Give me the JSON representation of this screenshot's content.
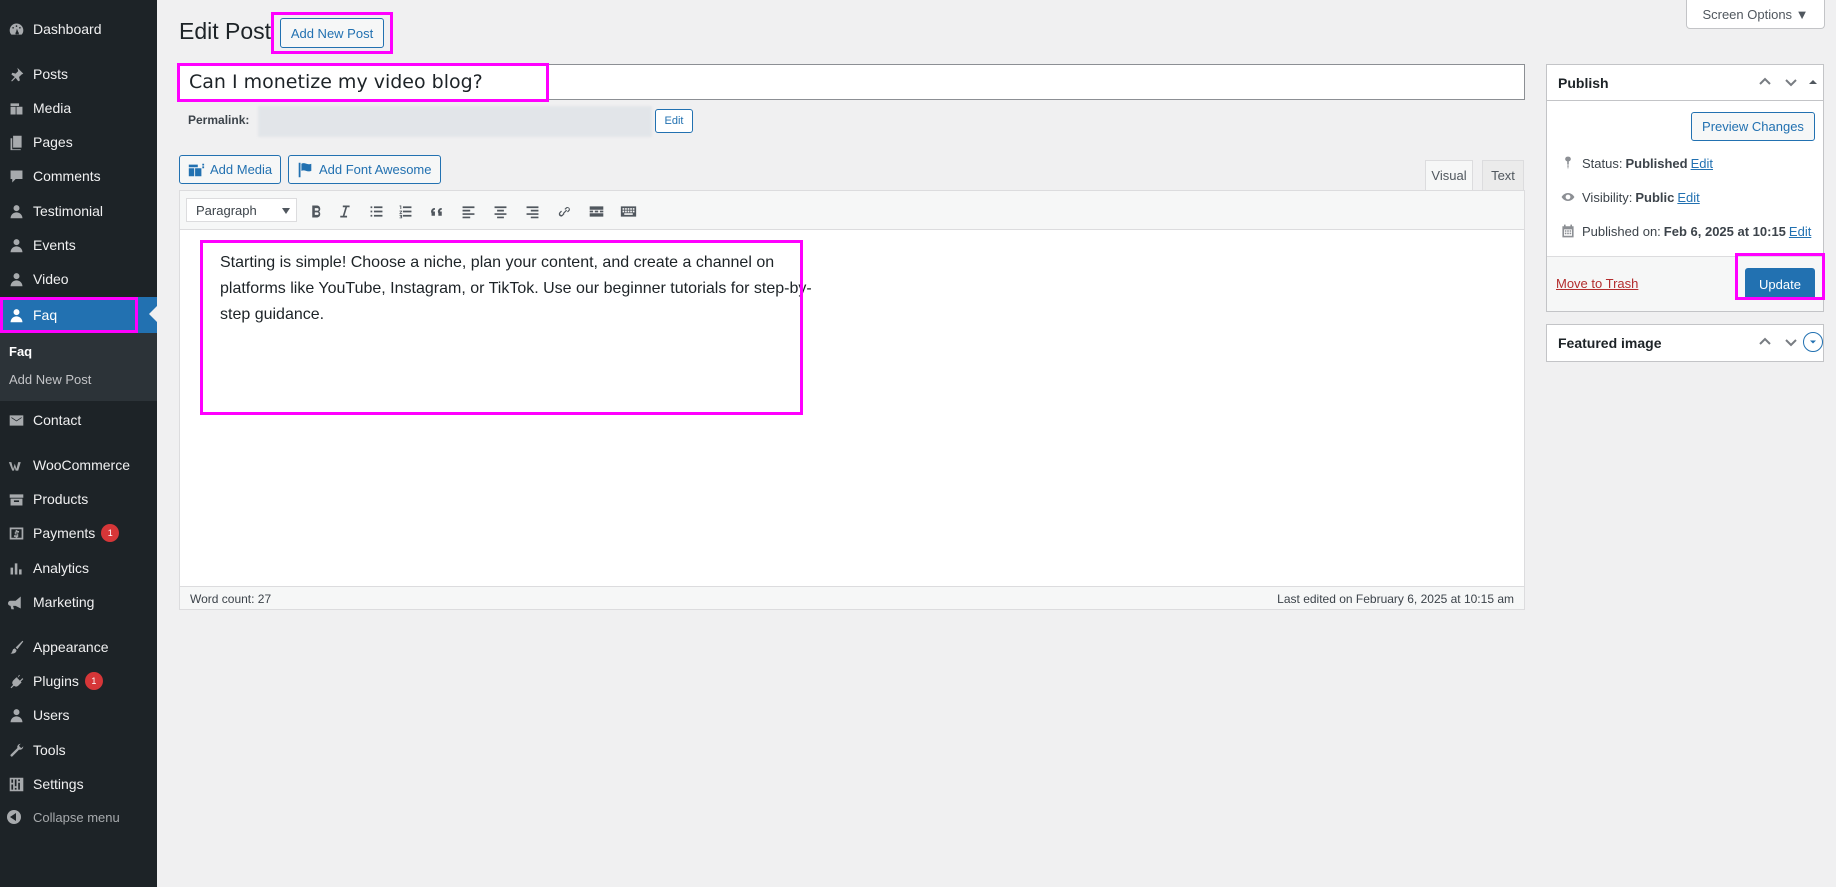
{
  "sidebar": {
    "items": [
      {
        "label": "Dashboard",
        "icon": "dashboard-icon"
      },
      {
        "label": "Posts",
        "icon": "pin-icon"
      },
      {
        "label": "Media",
        "icon": "media-icon"
      },
      {
        "label": "Pages",
        "icon": "pages-icon"
      },
      {
        "label": "Comments",
        "icon": "comments-icon"
      },
      {
        "label": "Testimonial",
        "icon": "user-icon"
      },
      {
        "label": "Events",
        "icon": "user-icon"
      },
      {
        "label": "Video",
        "icon": "user-icon"
      },
      {
        "label": "Faq",
        "icon": "user-icon"
      },
      {
        "label": "Contact",
        "icon": "mail-icon"
      },
      {
        "label": "WooCommerce",
        "icon": "woo-icon"
      },
      {
        "label": "Products",
        "icon": "archive-icon"
      },
      {
        "label": "Payments",
        "icon": "dollar-icon",
        "badge": "1"
      },
      {
        "label": "Analytics",
        "icon": "chart-icon"
      },
      {
        "label": "Marketing",
        "icon": "megaphone-icon"
      },
      {
        "label": "Appearance",
        "icon": "brush-icon"
      },
      {
        "label": "Plugins",
        "icon": "plugin-icon",
        "badge": "1"
      },
      {
        "label": "Users",
        "icon": "user-icon"
      },
      {
        "label": "Tools",
        "icon": "wrench-icon"
      },
      {
        "label": "Settings",
        "icon": "settings-icon"
      }
    ],
    "submenu": {
      "current": "Faq",
      "add_new": "Add New Post"
    },
    "collapse": "Collapse menu"
  },
  "header": {
    "title": "Edit Post",
    "add_new": "Add New Post",
    "screen_options": "Screen Options ▼"
  },
  "post": {
    "title": "Can I monetize my video blog?",
    "permalink_label": "Permalink:",
    "permalink_edit": "Edit",
    "content": "Starting is simple! Choose a niche, plan your content, and create a channel on platforms like YouTube, Instagram, or TikTok. Use our beginner tutorials for step-by-step guidance."
  },
  "editor": {
    "add_media": "Add Media",
    "add_font_awesome": "Add Font Awesome",
    "tab_visual": "Visual",
    "tab_text": "Text",
    "format": "Paragraph",
    "word_count": "Word count: 27",
    "last_edited": "Last edited on February 6, 2025 at 10:15 am"
  },
  "publish": {
    "title": "Publish",
    "preview": "Preview Changes",
    "status_label": "Status:",
    "status_value": "Published",
    "visibility_label": "Visibility:",
    "visibility_value": "Public",
    "published_label": "Published on:",
    "published_value": "Feb 6, 2025 at 10:15",
    "edit": "Edit",
    "trash": "Move to Trash",
    "update": "Update"
  },
  "featured": {
    "title": "Featured image"
  },
  "colors": {
    "accent": "#2271b1",
    "sidebar": "#1d2327",
    "highlight": "#ff00ff",
    "danger": "#b32d2e"
  }
}
